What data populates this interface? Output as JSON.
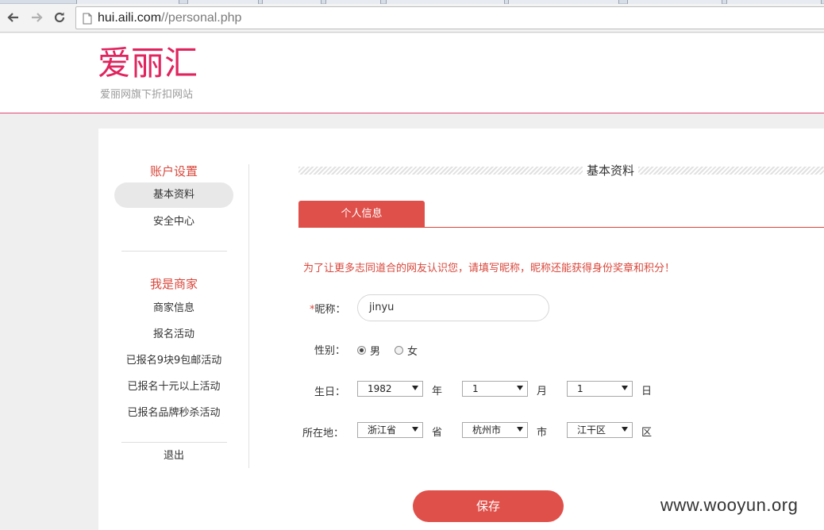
{
  "browser": {
    "url_domain": "hui.aili.com",
    "url_path": "//personal.php"
  },
  "header": {
    "logo_text": "爱丽汇",
    "tagline": "爱丽网旗下折扣网站"
  },
  "sidebar": {
    "account_heading": "账户设置",
    "account_items": [
      {
        "label": "基本资料",
        "active": true
      },
      {
        "label": "安全中心",
        "active": false
      }
    ],
    "merchant_heading": "我是商家",
    "merchant_items": [
      {
        "label": "商家信息"
      },
      {
        "label": "报名活动"
      },
      {
        "label": "已报名9块9包邮活动"
      },
      {
        "label": "已报名十元以上活动"
      },
      {
        "label": "已报名品牌秒杀活动"
      }
    ],
    "logout_label": "退出"
  },
  "main": {
    "section_title": "基本资料",
    "tab_label": "个人信息",
    "notice": "为了让更多志同道合的网友认识您，请填写昵称，昵称还能获得身份奖章和积分！",
    "nickname": {
      "required_mark": "*",
      "label": "昵称：",
      "value": "jinyu"
    },
    "gender": {
      "label": "性别：",
      "options": [
        "男",
        "女"
      ],
      "selected": "男"
    },
    "birthday": {
      "label": "生日：",
      "year": "1982",
      "year_unit": "年",
      "month": "1",
      "month_unit": "月",
      "day": "1",
      "day_unit": "日"
    },
    "location": {
      "label": "所在地：",
      "province": "浙江省",
      "province_unit": "省",
      "city": "杭州市",
      "city_unit": "市",
      "district": "江干区",
      "district_unit": "区"
    },
    "save_label": "保存"
  },
  "watermark": "www.wooyun.org",
  "colors": {
    "brand": "#e0245e",
    "accent": "#e0504a",
    "notice": "#d9473b"
  }
}
